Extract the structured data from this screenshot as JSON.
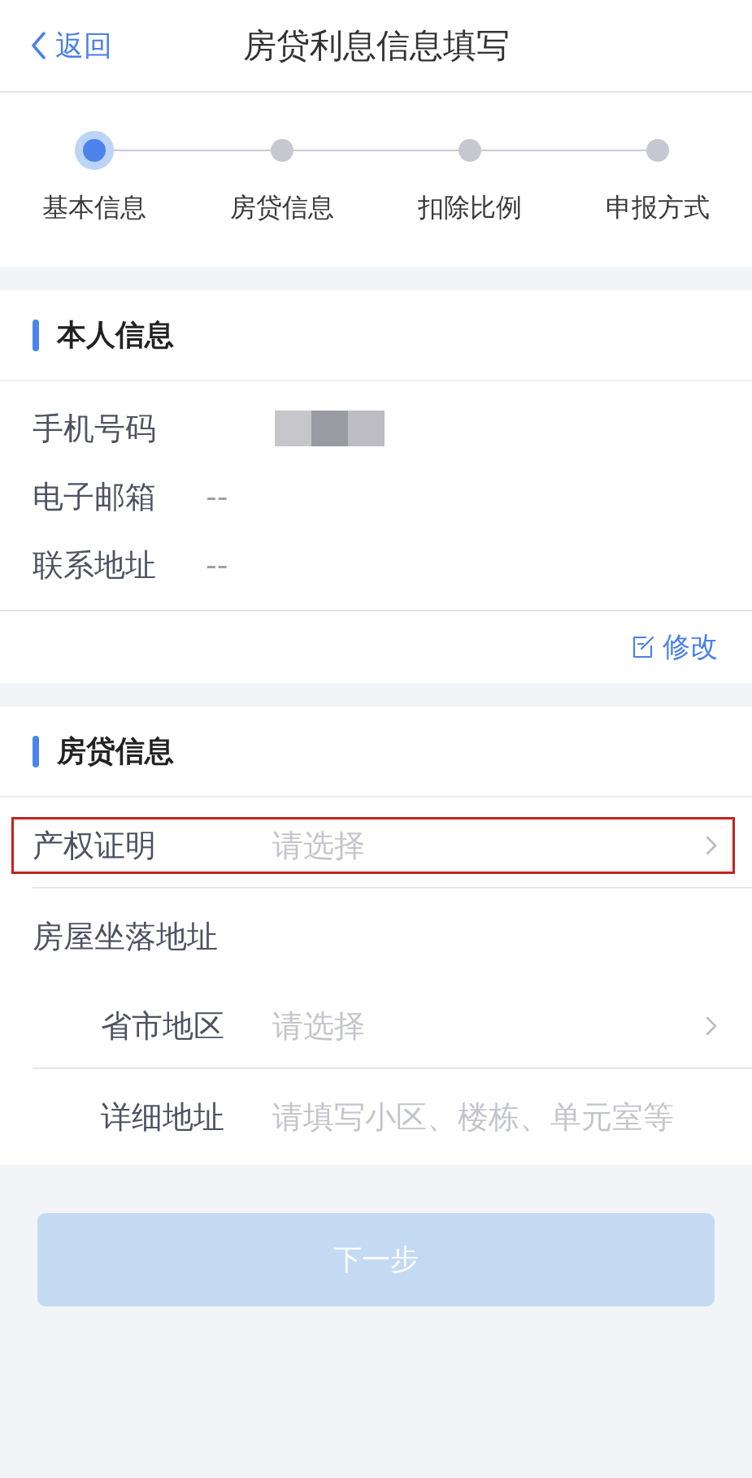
{
  "nav_bar": {
    "back": "返回",
    "title": "房贷利息信息填写"
  },
  "steps": [
    {
      "label": "基本信息",
      "selected": true
    },
    {
      "label": "房贷信息",
      "selected": false
    },
    {
      "label": "扣除比例",
      "selected": false
    },
    {
      "label": "申报方式",
      "selected": false
    }
  ],
  "personal_info": {
    "title": "本人信息",
    "rows": [
      {
        "kind": "redacted",
        "label": "手机号码"
      },
      {
        "kind": "text",
        "label": "电子邮箱",
        "value": "--"
      },
      {
        "kind": "text",
        "label": "联系地址",
        "value": "--"
      }
    ],
    "edit_link": "修改"
  },
  "mortgage_info": {
    "title": "房贷信息",
    "fields": [
      {
        "kind": "select",
        "label": "产权证明",
        "placeholder": "请选择",
        "highlighted": true
      },
      {
        "kind": "group",
        "label": "房屋坐落地址",
        "highlighted": false,
        "children": [
          {
            "kind": "select",
            "label": "省市地区",
            "placeholder": "请选择",
            "highlighted": false
          },
          {
            "kind": "input",
            "label": "详细地址",
            "placeholder": "请填写小区、楼栋、单元室等",
            "highlighted": false
          }
        ]
      }
    ]
  },
  "next_button": {
    "label": "下一步",
    "disabled": true
  }
}
